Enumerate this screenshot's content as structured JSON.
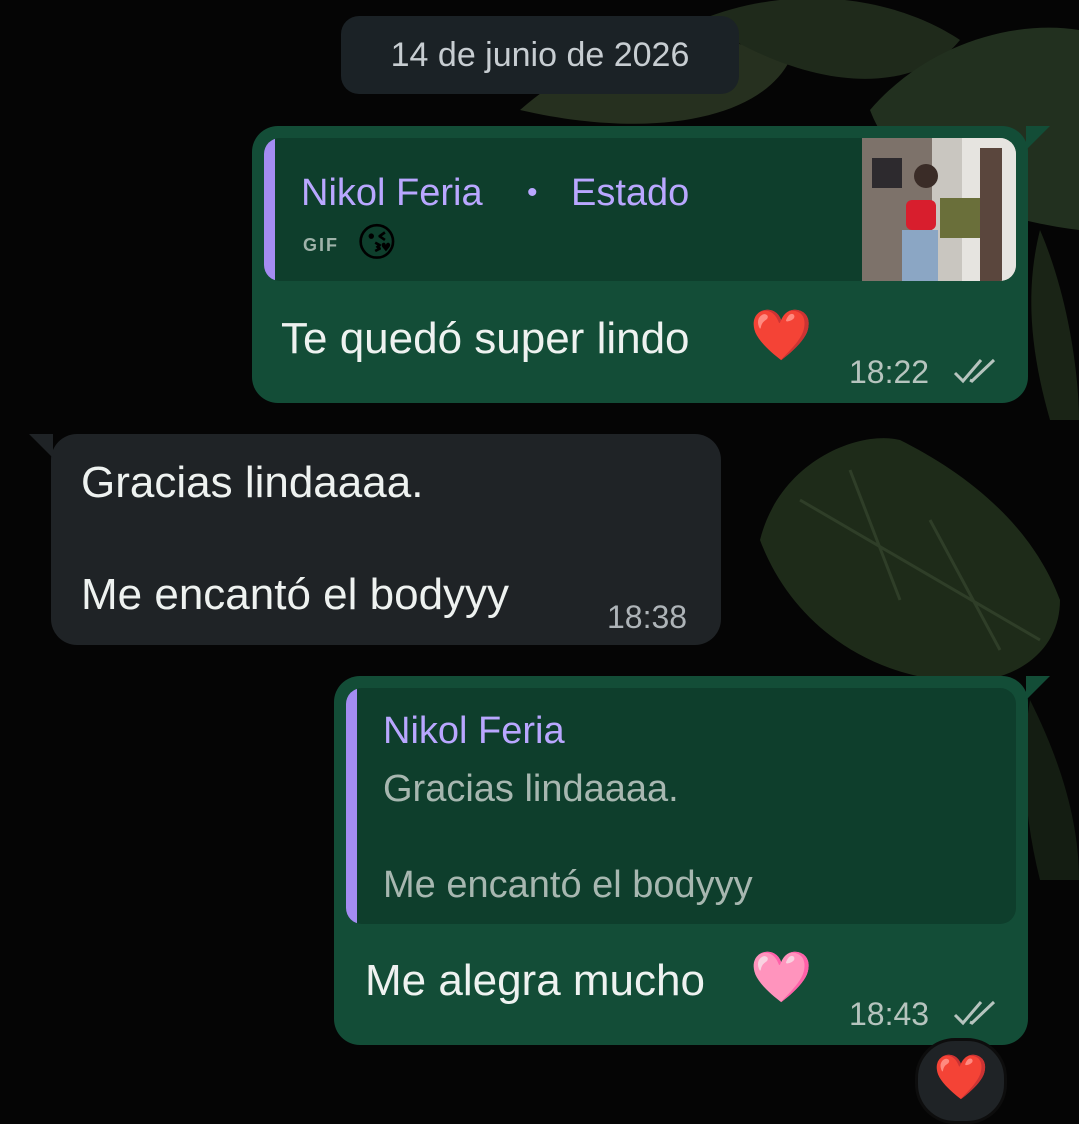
{
  "date_separator": "14 de junio de 2026",
  "messages": [
    {
      "direction": "outgoing",
      "reply": {
        "author": "Nikol Feria",
        "separator": "•",
        "source": "Estado",
        "media_label": "GIF",
        "emoji": "😘",
        "thumbnail": "status-photo"
      },
      "text": "Te quedó super lindo",
      "emoji": "❤️",
      "time": "18:22",
      "status": "read-double-check"
    },
    {
      "direction": "incoming",
      "lines": [
        "Gracias lindaaaa.",
        "Me encantó el bodyyy"
      ],
      "time": "18:38"
    },
    {
      "direction": "outgoing",
      "reply": {
        "author": "Nikol Feria",
        "lines": [
          "Gracias lindaaaa.",
          "Me encantó el bodyyy"
        ]
      },
      "text": "Me alegra mucho",
      "emoji": "🩷",
      "time": "18:43",
      "status": "read-double-check",
      "reaction": "❤️"
    }
  ],
  "colors": {
    "outgoing_bubble": "#134d37",
    "incoming_bubble": "#1f2326",
    "quote_accent": "#a48cf2",
    "author": "#b9a7ff"
  }
}
